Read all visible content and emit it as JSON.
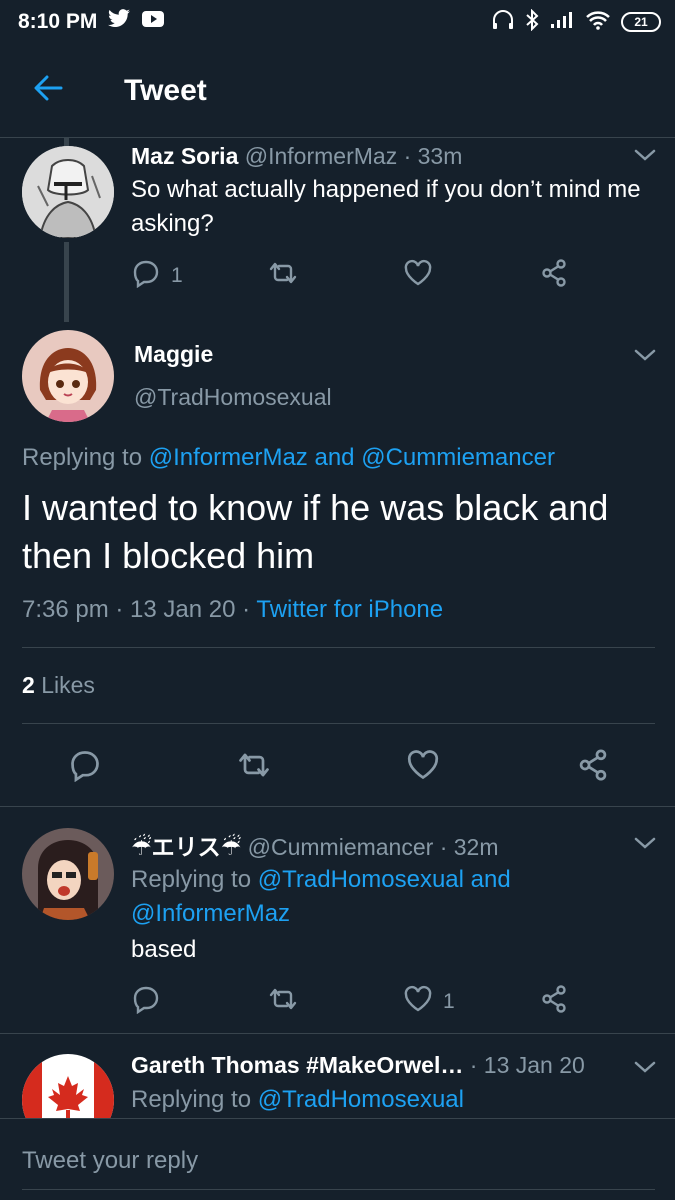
{
  "status_bar": {
    "time": "8:10 PM",
    "battery": "21"
  },
  "header": {
    "title": "Tweet"
  },
  "tweet1": {
    "name": "Maz Soria",
    "handle": "@InformerMaz",
    "time": "· 33m",
    "text": "So what actually happened if you don’t mind me asking?",
    "reply_count": "1"
  },
  "main": {
    "name": "Maggie",
    "handle": "@TradHomosexual",
    "replying_prefix": "Replying to",
    "replying_to_1": "@InformerMaz",
    "replying_and": "and",
    "replying_to_2": "@Cummiemancer",
    "text": "I wanted to know if he was black and then I blocked him",
    "timestamp": "7:36 pm · 13 Jan 20 ·",
    "source": "Twitter for iPhone",
    "likes_count": "2",
    "likes_label": "Likes"
  },
  "reply2": {
    "name": "☔エリス☔",
    "handle": "@Cummiemancer",
    "time": "· 32m",
    "replying_prefix": "Replying to",
    "replying_to_1": "@TradHomosexual",
    "replying_and": "and",
    "replying_to_2": "@InformerMaz",
    "text": "based",
    "like_count": "1"
  },
  "reply3": {
    "name": "Gareth Thomas #MakeOrwel…",
    "time": "· 13 Jan 20",
    "replying_prefix": "Replying to",
    "replying_to_1": "@TradHomosexual"
  },
  "composer": {
    "placeholder": "Tweet your reply"
  }
}
